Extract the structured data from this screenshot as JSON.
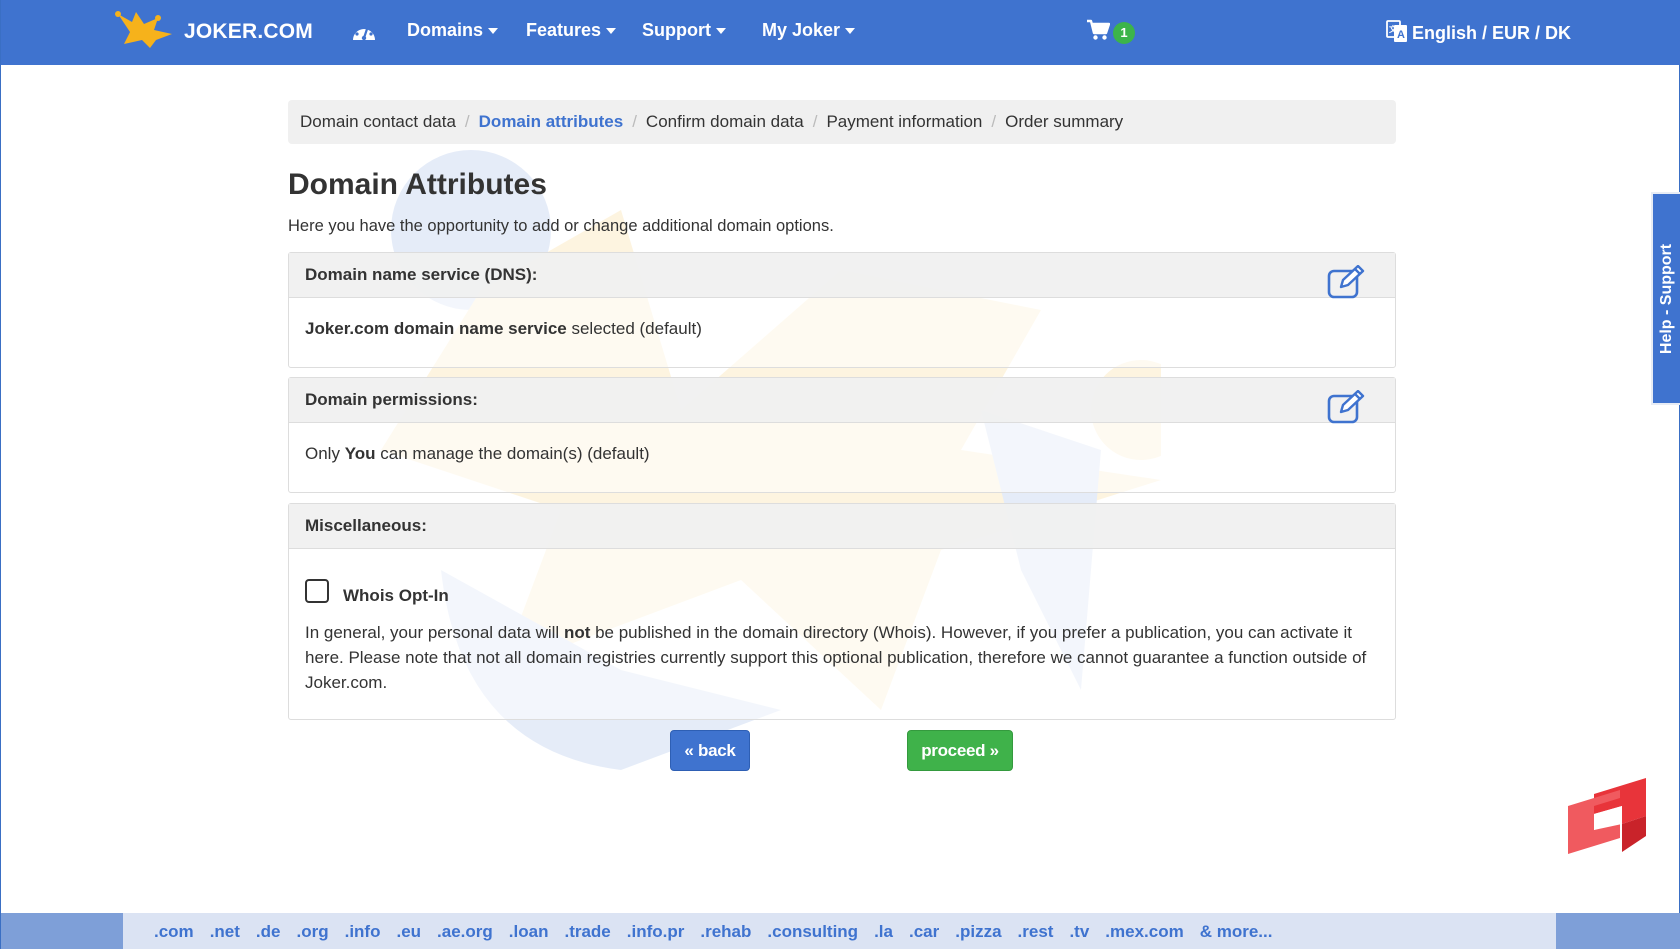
{
  "colors": {
    "nav_bg": "#3f73cf",
    "accent": "#3f73cf",
    "proceed": "#3fb24a",
    "badge": "#3cb44a",
    "logo_yellow": "#f6b21b"
  },
  "navbar": {
    "brand": "JOKER.COM",
    "menu": [
      {
        "label": "Domains"
      },
      {
        "label": "Features"
      },
      {
        "label": "Support"
      },
      {
        "label": "My Joker"
      }
    ],
    "cart_count": "1",
    "language": "English / EUR / DK",
    "icons": [
      "joker-logo-icon",
      "dashboard-icon",
      "cart-icon",
      "translate-icon"
    ]
  },
  "breadcrumb": [
    {
      "label": "Domain contact data"
    },
    {
      "label": "Domain attributes",
      "active": true
    },
    {
      "label": "Confirm domain data"
    },
    {
      "label": "Payment information"
    },
    {
      "label": "Order summary"
    }
  ],
  "page": {
    "title": "Domain Attributes",
    "intro": "Here you have the opportunity to add or change additional domain options."
  },
  "panels": {
    "dns": {
      "heading": "Domain name service (DNS):",
      "value_bold": "Joker.com domain name service",
      "value_rest": " selected (default)"
    },
    "permissions": {
      "heading": "Domain permissions:",
      "pre": "Only ",
      "bold": "You",
      "post": " can manage the domain(s) (default)"
    },
    "misc": {
      "heading": "Miscellaneous:",
      "checkbox_label": "Whois Opt-In",
      "checkbox_checked": false,
      "text_pre": "In general, your personal data will ",
      "text_bold": "not",
      "text_post": " be published in the domain directory (Whois). However, if you prefer a publication, you can activate it here. Please note that not all domain registries currently support this optional publication, therefore we cannot guarantee a function outside of Joker.com."
    }
  },
  "buttons": {
    "back": "« back",
    "proceed": "proceed »"
  },
  "side": {
    "help": "Help - Support"
  },
  "tlds": [
    ".com",
    ".net",
    ".de",
    ".org",
    ".info",
    ".eu",
    ".ae.org",
    ".loan",
    ".trade",
    ".info.pr",
    ".rehab",
    ".consulting",
    ".la",
    ".car",
    ".pizza",
    ".rest",
    ".tv",
    ".mex.com",
    "& more..."
  ]
}
